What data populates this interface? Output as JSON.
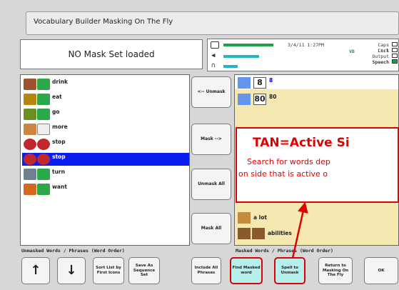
{
  "title": "Vocabulary Builder Masking On The Fly",
  "mask_status": "NO Mask Set loaded",
  "status": {
    "datetime": "3/4/11 1:27PM",
    "mode": "VB",
    "caps_lock": "Caps Lock",
    "ctrl": "Ctrl",
    "output": "Output",
    "speech": "Speech"
  },
  "left_list": {
    "items": [
      {
        "label": "drink"
      },
      {
        "label": "eat"
      },
      {
        "label": "go"
      },
      {
        "label": "more"
      },
      {
        "label": "stop"
      },
      {
        "label": "stop",
        "selected": true
      },
      {
        "label": "turn"
      },
      {
        "label": "want"
      }
    ],
    "section_label": "Unmasked Words / Phrases (Word Order)"
  },
  "middle_buttons": {
    "unmask": "<-- Unmask",
    "mask": "Mask -->",
    "unmask_all": "Unmask All",
    "mask_all": "Mask All"
  },
  "right_list": {
    "items": [
      {
        "num": "8",
        "label": "8"
      },
      {
        "num": "80",
        "label": "80"
      },
      {
        "num": "",
        "label": "a lot"
      },
      {
        "num": "",
        "label": "abilities"
      }
    ],
    "section_label": "Masked Words / Phrases (Word Order)"
  },
  "overlay": {
    "title": "TAN=Active Si",
    "line1": "Search for words dep",
    "line2": "on side that is active o"
  },
  "bottom_buttons": {
    "up": "↑",
    "down": "↓",
    "sort": "Sort List by First Icons",
    "save_as": "Save As Sequence Set",
    "include_all": "Include All Phrases",
    "find_masked": "Find Masked word",
    "spell_unmask": "Spell to Unmask",
    "return": "Return to Masking On The Fly",
    "ok": "OK"
  },
  "colors": {
    "accent_red": "#e00000",
    "selection_blue": "#0a1ef0",
    "tan_active": "#f5e8b0",
    "teal_button": "#b6f0ec"
  }
}
